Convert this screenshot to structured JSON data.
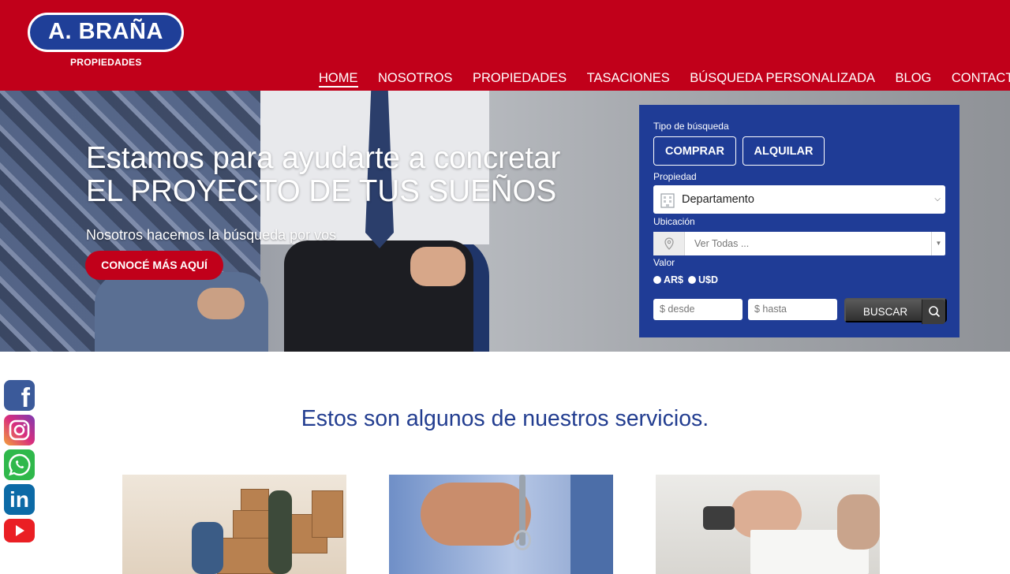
{
  "header": {
    "logo_text": "A. BRAÑA",
    "logo_subtitle": "PROPIEDADES",
    "nav": [
      {
        "label": "HOME",
        "active": true
      },
      {
        "label": "NOSOTROS",
        "active": false
      },
      {
        "label": "PROPIEDADES",
        "active": false
      },
      {
        "label": "TASACIONES",
        "active": false
      },
      {
        "label": "BÚSQUEDA PERSONALIZADA",
        "active": false
      },
      {
        "label": "BLOG",
        "active": false
      },
      {
        "label": "CONTACTO",
        "active": false
      }
    ]
  },
  "hero": {
    "title_line1": "Estamos para ayudarte a concretar",
    "title_line2": "EL PROYECTO DE TUS SUEÑOS",
    "subtitle": "Nosotros hacemos la búsqueda por vos",
    "cta_label": "CONOCÉ MÁS AQUÍ"
  },
  "search": {
    "tipo_label": "Tipo de búsqueda",
    "comprar_label": "COMPRAR",
    "alquilar_label": "ALQUILAR",
    "propiedad_label": "Propiedad",
    "propiedad_value": "Departamento",
    "ubicacion_label": "Ubicación",
    "ubicacion_placeholder": "Ver Todas ...",
    "valor_label": "Valor",
    "currency_ars": "AR$",
    "currency_usd": "U$D",
    "desde_placeholder": "$ desde",
    "hasta_placeholder": "$ hasta",
    "buscar_label": "BUSCAR"
  },
  "social": {
    "facebook": "f",
    "instagram": "instagram-icon",
    "whatsapp": "whatsapp-icon",
    "linkedin": "in",
    "youtube": "youtube-icon"
  },
  "services": {
    "title": "Estos son algunos de nuestros servicios."
  },
  "colors": {
    "brand_red": "#c1001a",
    "brand_blue": "#1f3c96",
    "title_blue": "#223d90"
  }
}
